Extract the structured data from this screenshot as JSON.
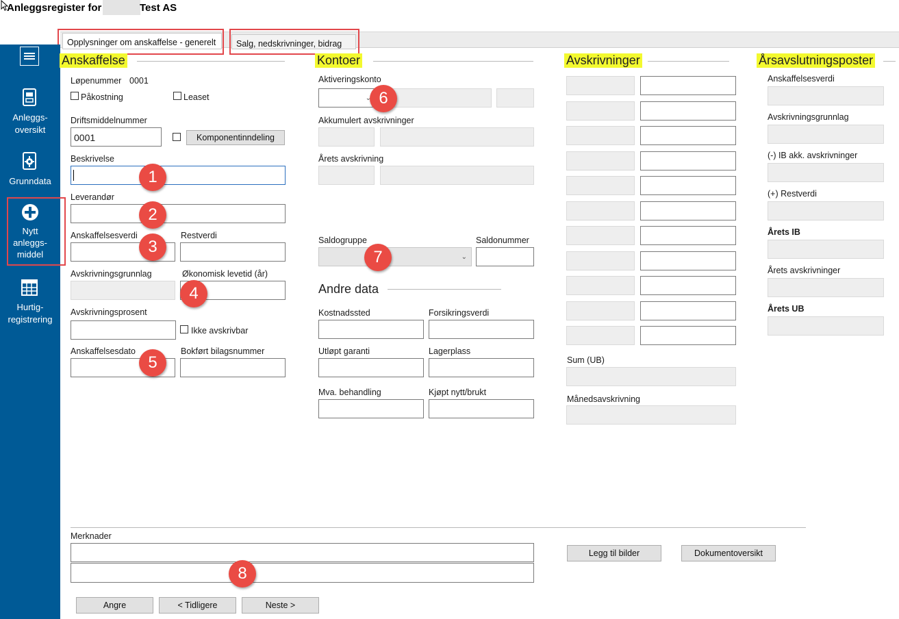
{
  "window": {
    "title_prefix": "Anleggsregister for",
    "title_suffix": "Test AS"
  },
  "tabs": [
    {
      "label": "Opplysninger om anskaffelse - generelt"
    },
    {
      "label": "Salg, nedskrivninger, bidrag"
    }
  ],
  "sidebar": {
    "menu_icon": "hamburger-icon",
    "items": [
      {
        "label_lines": [
          "Anleggs-",
          "oversikt"
        ],
        "icon": "document-icon"
      },
      {
        "label_lines": [
          "Grunndata"
        ],
        "icon": "gear-document-icon"
      },
      {
        "label_lines": [
          "Nytt",
          "anleggs-",
          "middel"
        ],
        "icon": "plus-circle-icon"
      },
      {
        "label_lines": [
          "Hurtig-",
          "registrering"
        ],
        "icon": "grid-icon"
      }
    ]
  },
  "anskaffelse": {
    "heading": "Anskaffelse",
    "lopenummer_label": "Løpenummer",
    "lopenummer_value": "0001",
    "pakostning_label": "Påkostning",
    "leaset_label": "Leaset",
    "driftsmiddelnummer_label": "Driftsmiddelnummer",
    "driftsmiddelnummer_value": "0001",
    "komponent_button": "Komponentinndeling",
    "beskrivelse_label": "Beskrivelse",
    "leverandor_label": "Leverandør",
    "anskaffelsesverdi_label": "Anskaffelsesverdi",
    "restverdi_label": "Restverdi",
    "avskrivningsgrunnlag_label": "Avskrivningsgrunnlag",
    "levetid_label": "Økonomisk levetid (år)",
    "avskrivningsprosent_label": "Avskrivningsprosent",
    "ikke_avskrivbar_label": "Ikke avskrivbar",
    "anskaffelsesdato_label": "Anskaffelsesdato",
    "bilagsnummer_label": "Bokført bilagsnummer"
  },
  "kontoer": {
    "heading": "Kontoer",
    "aktiveringskonto_label": "Aktiveringskonto",
    "akkumulert_label": "Akkumulert avskrivninger",
    "arets_label": "Årets avskrivning",
    "saldogruppe_label": "Saldogruppe",
    "saldonummer_label": "Saldonummer"
  },
  "andre_data": {
    "heading": "Andre data",
    "kostnadssted_label": "Kostnadssted",
    "forsikringsverdi_label": "Forsikringsverdi",
    "utlopt_garanti_label": "Utløpt garanti",
    "lagerplass_label": "Lagerplass",
    "mva_label": "Mva. behandling",
    "kjopt_label": "Kjøpt nytt/brukt"
  },
  "avskrivninger": {
    "heading": "Avskrivninger",
    "row_count": 11,
    "sum_label": "Sum (UB)",
    "maned_label": "Månedsavskrivning"
  },
  "arsavslutning": {
    "heading": "Årsavslutningsposter",
    "items": [
      {
        "label": "Anskaffelsesverdi",
        "bold": false
      },
      {
        "label": "Avskrivningsgrunnlag",
        "bold": false
      },
      {
        "label": "(-) IB akk. avskrivninger",
        "bold": false
      },
      {
        "label": "(+) Restverdi",
        "bold": false
      },
      {
        "label": "Årets IB",
        "bold": true
      },
      {
        "label": "Årets avskrivninger",
        "bold": false
      },
      {
        "label": "Årets UB",
        "bold": true
      }
    ]
  },
  "merknader": {
    "label": "Merknader"
  },
  "buttons": {
    "legg_til_bilder": "Legg til bilder",
    "dokumentoversikt": "Dokumentoversikt",
    "angre": "Angre",
    "tidligere": "< Tidligere",
    "neste": "Neste >"
  },
  "annotations": [
    "1",
    "2",
    "3",
    "4",
    "5",
    "6",
    "7",
    "8"
  ],
  "colors": {
    "sidebar": "#005a96",
    "highlight": "#f3f92f",
    "annotation": "#ea4b44",
    "frame": "#e2474b"
  }
}
